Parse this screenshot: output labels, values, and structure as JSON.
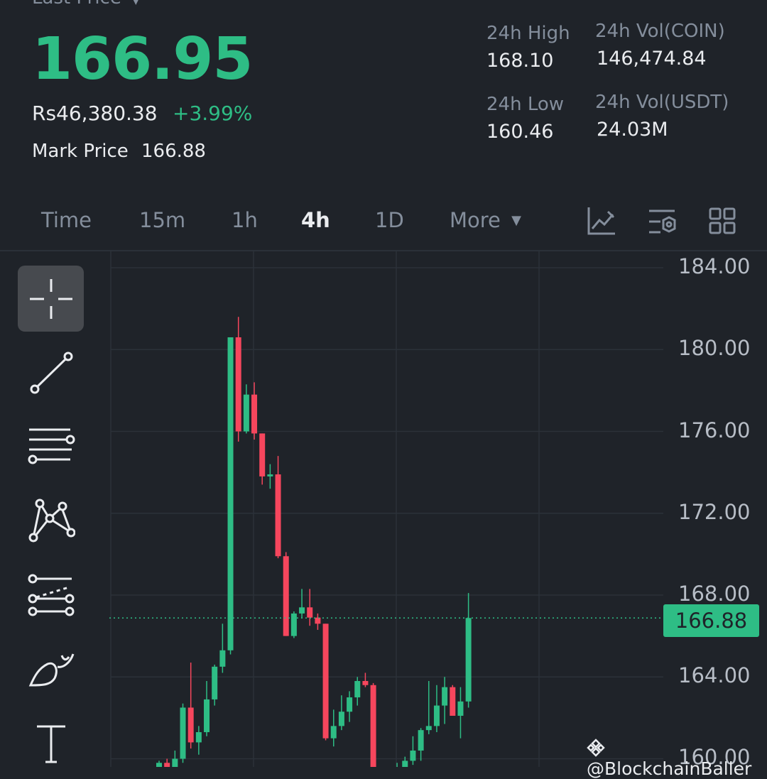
{
  "header": {
    "last_price_label": "Last Price",
    "last_price": "166.95",
    "fiat_price": "Rs46,380.38",
    "change_pct": "+3.99%",
    "mark_price_label": "Mark Price",
    "mark_price": "166.88"
  },
  "stats": {
    "high_label": "24h High",
    "high_value": "168.10",
    "low_label": "24h Low",
    "low_value": "160.46",
    "vol_coin_label": "24h Vol(COIN)",
    "vol_coin_value": "146,474.84",
    "vol_usdt_label": "24h Vol(USDT)",
    "vol_usdt_value": "24.03M"
  },
  "timeframes": [
    {
      "label": "Time",
      "active": false
    },
    {
      "label": "15m",
      "active": false
    },
    {
      "label": "1h",
      "active": false
    },
    {
      "label": "4h",
      "active": true
    },
    {
      "label": "1D",
      "active": false
    },
    {
      "label": "More",
      "active": false
    }
  ],
  "toolbar_icons": [
    "indicator-chart-icon",
    "chart-settings-icon",
    "layout-grid-icon"
  ],
  "drawing_tools": [
    "crosshair-icon",
    "trend-line-icon",
    "horizontal-lines-icon",
    "pattern-icon",
    "fib-lines-icon",
    "brush-icon",
    "text-icon"
  ],
  "colors": {
    "up": "#2ebd85",
    "down": "#f6465d",
    "background": "#1f2329"
  },
  "watermark": "@BlockchainBaller",
  "chart_data": {
    "type": "candlestick",
    "interval": "4h",
    "y_ticks": [
      "184.00",
      "180.00",
      "176.00",
      "172.00",
      "168.00",
      "164.00",
      "160.00"
    ],
    "ylim": [
      159.6,
      184.8
    ],
    "current_price_label": "166.88",
    "current_price": 166.88,
    "candles": [
      {
        "o": 159.5,
        "h": 159.9,
        "l": 159.3,
        "c": 159.8
      },
      {
        "o": 159.8,
        "h": 160.0,
        "l": 159.5,
        "c": 159.6
      },
      {
        "o": 159.6,
        "h": 160.4,
        "l": 159.4,
        "c": 160.0
      },
      {
        "o": 160.0,
        "h": 162.7,
        "l": 159.8,
        "c": 162.5
      },
      {
        "o": 162.5,
        "h": 164.7,
        "l": 160.5,
        "c": 160.8
      },
      {
        "o": 160.8,
        "h": 161.6,
        "l": 160.2,
        "c": 161.3
      },
      {
        "o": 161.3,
        "h": 163.8,
        "l": 161.1,
        "c": 162.9
      },
      {
        "o": 162.9,
        "h": 164.6,
        "l": 162.6,
        "c": 164.5
      },
      {
        "o": 164.5,
        "h": 166.6,
        "l": 164.2,
        "c": 165.3
      },
      {
        "o": 165.3,
        "h": 166.9,
        "l": 165.1,
        "c": 180.6
      },
      {
        "o": 180.6,
        "h": 181.6,
        "l": 175.5,
        "c": 176.0
      },
      {
        "o": 176.0,
        "h": 178.3,
        "l": 175.9,
        "c": 177.8
      },
      {
        "o": 177.8,
        "h": 178.4,
        "l": 175.6,
        "c": 175.9
      },
      {
        "o": 175.9,
        "h": 175.9,
        "l": 173.4,
        "c": 173.8
      },
      {
        "o": 173.8,
        "h": 174.4,
        "l": 173.2,
        "c": 173.9
      },
      {
        "o": 173.9,
        "h": 174.8,
        "l": 169.8,
        "c": 169.9
      },
      {
        "o": 169.9,
        "h": 170.1,
        "l": 166.0,
        "c": 166.0
      },
      {
        "o": 166.0,
        "h": 167.2,
        "l": 165.9,
        "c": 167.1
      },
      {
        "o": 167.1,
        "h": 168.3,
        "l": 166.9,
        "c": 167.4
      },
      {
        "o": 167.4,
        "h": 168.3,
        "l": 166.5,
        "c": 166.9
      },
      {
        "o": 166.9,
        "h": 167.1,
        "l": 166.3,
        "c": 166.6
      },
      {
        "o": 166.6,
        "h": 166.6,
        "l": 160.9,
        "c": 161.0
      },
      {
        "o": 161.0,
        "h": 162.4,
        "l": 160.6,
        "c": 161.6
      },
      {
        "o": 161.6,
        "h": 163.1,
        "l": 161.4,
        "c": 162.3
      },
      {
        "o": 162.3,
        "h": 163.3,
        "l": 161.8,
        "c": 163.0
      },
      {
        "o": 163.0,
        "h": 164.0,
        "l": 162.6,
        "c": 163.8
      },
      {
        "o": 163.8,
        "h": 164.2,
        "l": 163.5,
        "c": 163.6
      },
      {
        "o": 163.6,
        "h": 163.7,
        "l": 159.5,
        "c": 159.6
      },
      {
        "o": 159.0,
        "h": 159.4,
        "l": 158.6,
        "c": 159.0
      },
      {
        "o": 159.0,
        "h": 159.4,
        "l": 158.7,
        "c": 159.2
      },
      {
        "o": 159.2,
        "h": 159.8,
        "l": 159.0,
        "c": 159.6
      },
      {
        "o": 159.6,
        "h": 160.1,
        "l": 159.5,
        "c": 159.9
      },
      {
        "o": 159.9,
        "h": 161.1,
        "l": 159.7,
        "c": 160.4
      },
      {
        "o": 160.4,
        "h": 161.5,
        "l": 159.9,
        "c": 161.4
      },
      {
        "o": 161.4,
        "h": 163.8,
        "l": 161.2,
        "c": 161.6
      },
      {
        "o": 161.6,
        "h": 163.6,
        "l": 161.3,
        "c": 162.6
      },
      {
        "o": 162.6,
        "h": 164.0,
        "l": 161.7,
        "c": 163.5
      },
      {
        "o": 163.5,
        "h": 163.6,
        "l": 162.3,
        "c": 162.1
      },
      {
        "o": 162.1,
        "h": 163.5,
        "l": 161.0,
        "c": 162.8
      },
      {
        "o": 162.8,
        "h": 168.1,
        "l": 162.5,
        "c": 166.88
      }
    ]
  }
}
